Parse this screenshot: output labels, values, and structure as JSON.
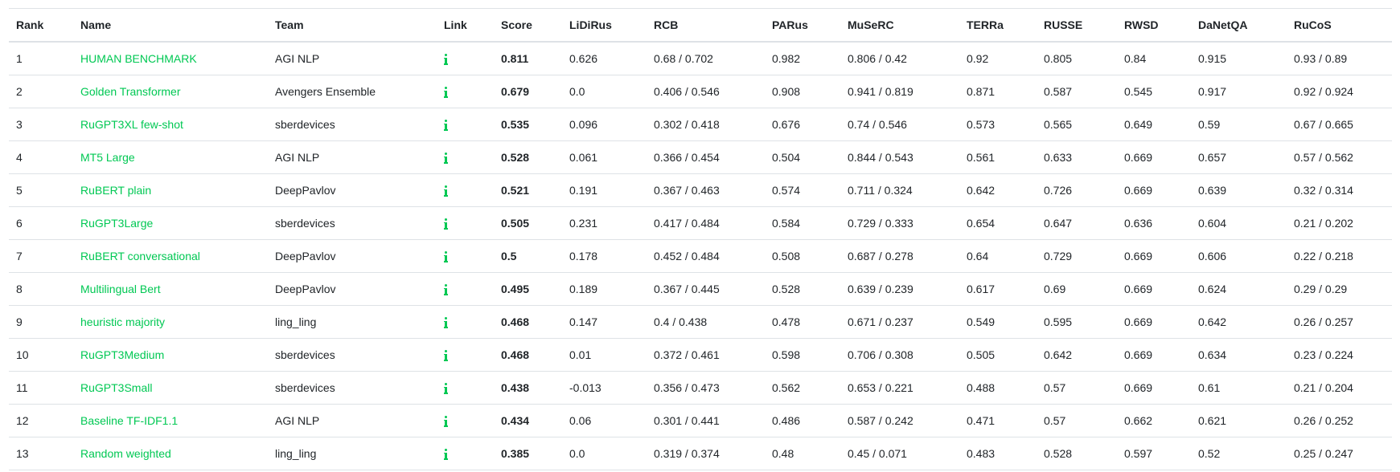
{
  "leaderboard": {
    "columns": [
      "Rank",
      "Name",
      "Team",
      "Link",
      "Score",
      "LiDiRus",
      "RCB",
      "PARus",
      "MuSeRC",
      "TERRa",
      "RUSSE",
      "RWSD",
      "DaNetQA",
      "RuCoS"
    ],
    "link_icon": "info-icon",
    "accent_color": "#00c853",
    "rows": [
      {
        "rank": "1",
        "name": "HUMAN BENCHMARK",
        "team": "AGI NLP",
        "score": "0.811",
        "lidirus": "0.626",
        "rcb": "0.68 / 0.702",
        "parus": "0.982",
        "muserc": "0.806 / 0.42",
        "terra": "0.92",
        "russe": "0.805",
        "rwsd": "0.84",
        "danetqa": "0.915",
        "rucos": "0.93 / 0.89"
      },
      {
        "rank": "2",
        "name": "Golden Transformer",
        "team": "Avengers Ensemble",
        "score": "0.679",
        "lidirus": "0.0",
        "rcb": "0.406 / 0.546",
        "parus": "0.908",
        "muserc": "0.941 / 0.819",
        "terra": "0.871",
        "russe": "0.587",
        "rwsd": "0.545",
        "danetqa": "0.917",
        "rucos": "0.92 / 0.924"
      },
      {
        "rank": "3",
        "name": "RuGPT3XL few-shot",
        "team": "sberdevices",
        "score": "0.535",
        "lidirus": "0.096",
        "rcb": "0.302 / 0.418",
        "parus": "0.676",
        "muserc": "0.74 / 0.546",
        "terra": "0.573",
        "russe": "0.565",
        "rwsd": "0.649",
        "danetqa": "0.59",
        "rucos": "0.67 / 0.665"
      },
      {
        "rank": "4",
        "name": "MT5 Large",
        "team": "AGI NLP",
        "score": "0.528",
        "lidirus": "0.061",
        "rcb": "0.366 / 0.454",
        "parus": "0.504",
        "muserc": "0.844 / 0.543",
        "terra": "0.561",
        "russe": "0.633",
        "rwsd": "0.669",
        "danetqa": "0.657",
        "rucos": "0.57 / 0.562"
      },
      {
        "rank": "5",
        "name": "RuBERT plain",
        "team": "DeepPavlov",
        "score": "0.521",
        "lidirus": "0.191",
        "rcb": "0.367 / 0.463",
        "parus": "0.574",
        "muserc": "0.711 / 0.324",
        "terra": "0.642",
        "russe": "0.726",
        "rwsd": "0.669",
        "danetqa": "0.639",
        "rucos": "0.32 / 0.314"
      },
      {
        "rank": "6",
        "name": "RuGPT3Large",
        "team": "sberdevices",
        "score": "0.505",
        "lidirus": "0.231",
        "rcb": "0.417 / 0.484",
        "parus": "0.584",
        "muserc": "0.729 / 0.333",
        "terra": "0.654",
        "russe": "0.647",
        "rwsd": "0.636",
        "danetqa": "0.604",
        "rucos": "0.21 / 0.202"
      },
      {
        "rank": "7",
        "name": "RuBERT conversational",
        "team": "DeepPavlov",
        "score": "0.5",
        "lidirus": "0.178",
        "rcb": "0.452 / 0.484",
        "parus": "0.508",
        "muserc": "0.687 / 0.278",
        "terra": "0.64",
        "russe": "0.729",
        "rwsd": "0.669",
        "danetqa": "0.606",
        "rucos": "0.22 / 0.218"
      },
      {
        "rank": "8",
        "name": "Multilingual Bert",
        "team": "DeepPavlov",
        "score": "0.495",
        "lidirus": "0.189",
        "rcb": "0.367 / 0.445",
        "parus": "0.528",
        "muserc": "0.639 / 0.239",
        "terra": "0.617",
        "russe": "0.69",
        "rwsd": "0.669",
        "danetqa": "0.624",
        "rucos": "0.29 / 0.29"
      },
      {
        "rank": "9",
        "name": "heuristic majority",
        "team": "ling_ling",
        "score": "0.468",
        "lidirus": "0.147",
        "rcb": "0.4 / 0.438",
        "parus": "0.478",
        "muserc": "0.671 / 0.237",
        "terra": "0.549",
        "russe": "0.595",
        "rwsd": "0.669",
        "danetqa": "0.642",
        "rucos": "0.26 / 0.257"
      },
      {
        "rank": "10",
        "name": "RuGPT3Medium",
        "team": "sberdevices",
        "score": "0.468",
        "lidirus": "0.01",
        "rcb": "0.372 / 0.461",
        "parus": "0.598",
        "muserc": "0.706 / 0.308",
        "terra": "0.505",
        "russe": "0.642",
        "rwsd": "0.669",
        "danetqa": "0.634",
        "rucos": "0.23 / 0.224"
      },
      {
        "rank": "11",
        "name": "RuGPT3Small",
        "team": "sberdevices",
        "score": "0.438",
        "lidirus": "-0.013",
        "rcb": "0.356 / 0.473",
        "parus": "0.562",
        "muserc": "0.653 / 0.221",
        "terra": "0.488",
        "russe": "0.57",
        "rwsd": "0.669",
        "danetqa": "0.61",
        "rucos": "0.21 / 0.204"
      },
      {
        "rank": "12",
        "name": "Baseline TF-IDF1.1",
        "team": "AGI NLP",
        "score": "0.434",
        "lidirus": "0.06",
        "rcb": "0.301 / 0.441",
        "parus": "0.486",
        "muserc": "0.587 / 0.242",
        "terra": "0.471",
        "russe": "0.57",
        "rwsd": "0.662",
        "danetqa": "0.621",
        "rucos": "0.26 / 0.252"
      },
      {
        "rank": "13",
        "name": "Random weighted",
        "team": "ling_ling",
        "score": "0.385",
        "lidirus": "0.0",
        "rcb": "0.319 / 0.374",
        "parus": "0.48",
        "muserc": "0.45 / 0.071",
        "terra": "0.483",
        "russe": "0.528",
        "rwsd": "0.597",
        "danetqa": "0.52",
        "rucos": "0.25 / 0.247"
      }
    ]
  }
}
